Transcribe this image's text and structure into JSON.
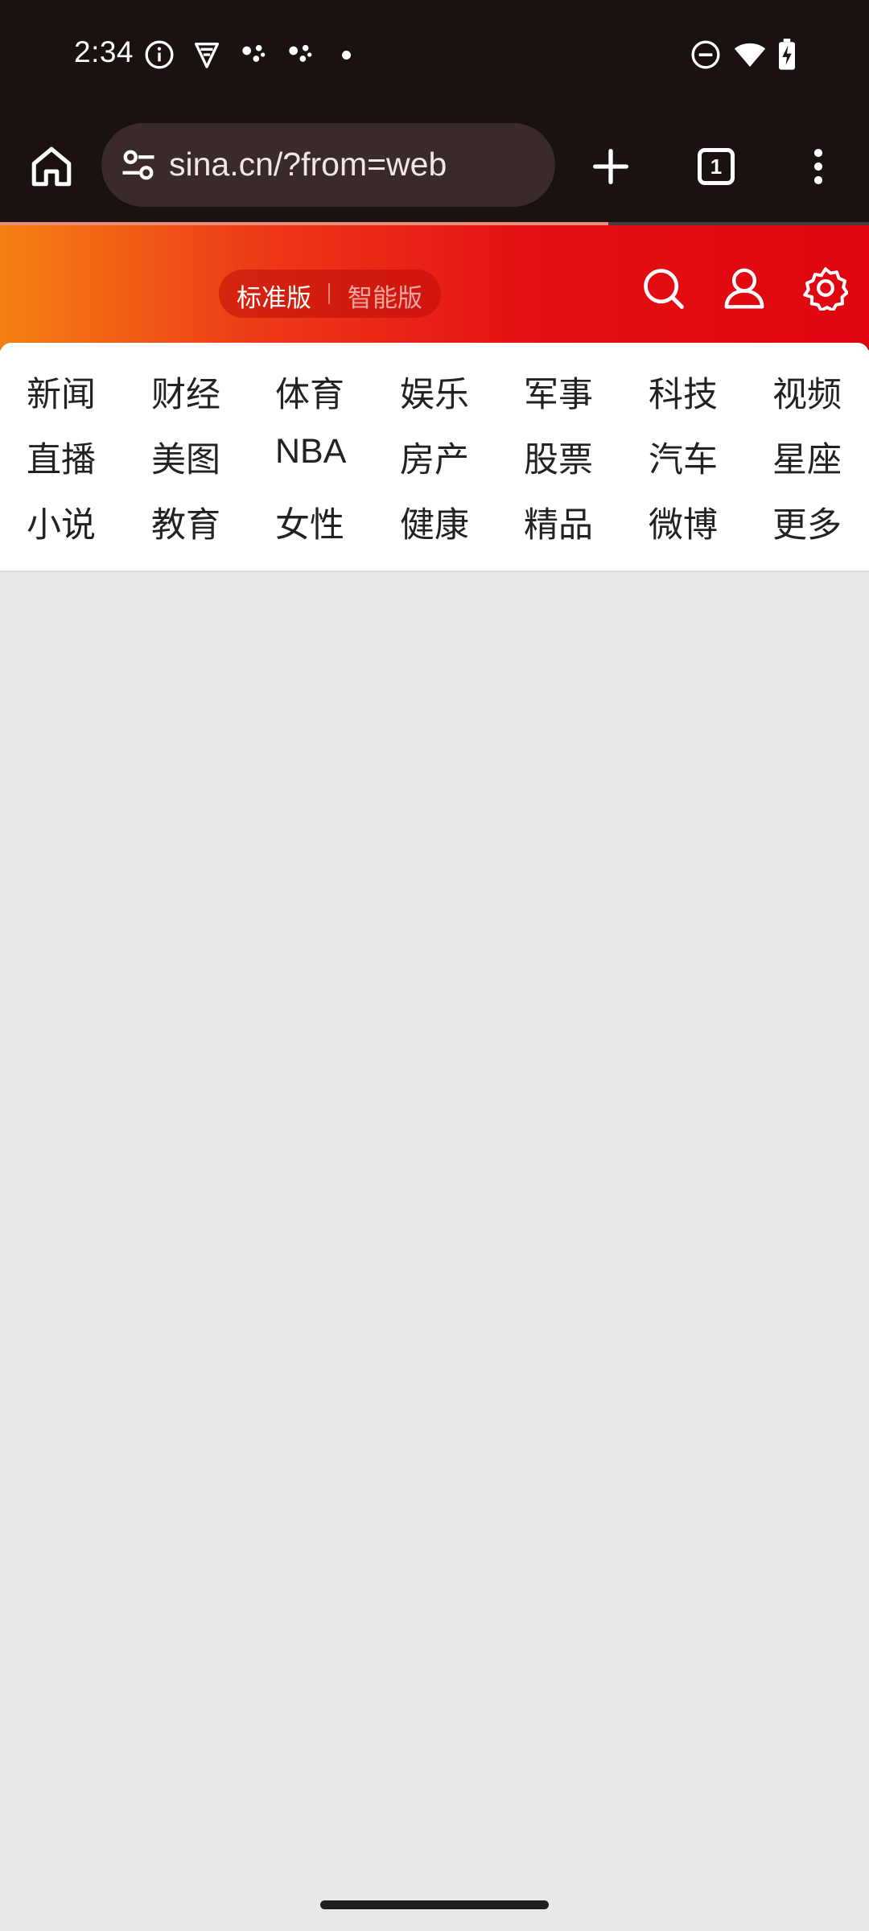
{
  "status_bar": {
    "time": "2:34",
    "left_icons": [
      "info-icon",
      "vpn-shield-icon",
      "assistant-dots-icon",
      "assistant-dots-icon",
      "notification-dot"
    ],
    "right_icons": [
      "do-not-disturb-icon",
      "wifi-icon",
      "battery-charging-icon"
    ]
  },
  "browser": {
    "url": "sina.cn/?from=web",
    "tab_count": "1",
    "load_progress": 0.7,
    "icons": [
      "home-icon",
      "site-settings-icon",
      "new-tab-plus-icon",
      "tab-switcher-icon",
      "more-vert-icon"
    ]
  },
  "header": {
    "standard_version": "标准版",
    "smart_version": "智能版",
    "icons": [
      "search-icon",
      "user-icon",
      "settings-gear-icon"
    ],
    "gradient_colors": [
      "#f47f12",
      "#e0050f"
    ]
  },
  "categories": [
    [
      "新闻",
      "财经",
      "体育",
      "娱乐",
      "军事",
      "科技",
      "视频"
    ],
    [
      "直播",
      "美图",
      "NBA",
      "房产",
      "股票",
      "汽车",
      "星座"
    ],
    [
      "小说",
      "教育",
      "女性",
      "健康",
      "精品",
      "微博",
      "更多"
    ]
  ],
  "colors": {
    "system_bar": "#1a1111",
    "page_background": "#e8e8e8",
    "category_text": "#222222"
  }
}
